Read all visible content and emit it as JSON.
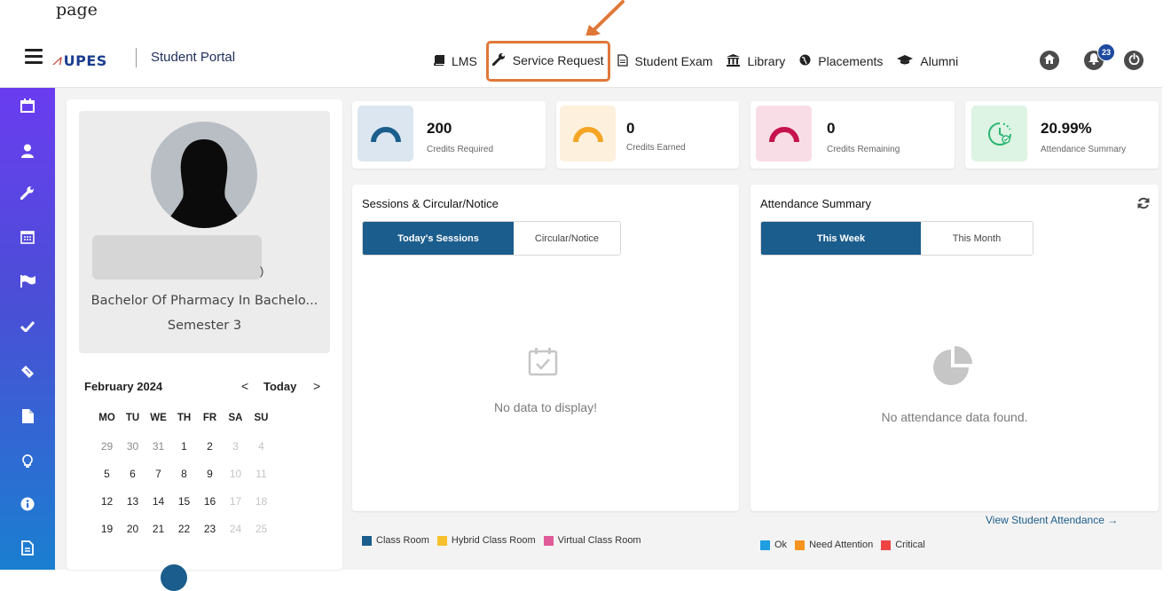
{
  "doc_label": "page",
  "header": {
    "brand": "UPES",
    "portal_title": "Student Portal",
    "nav": [
      {
        "label": "LMS",
        "icon": "book-icon"
      },
      {
        "label": "Service Request",
        "icon": "wrench-icon"
      },
      {
        "label": "Student Exam",
        "icon": "document-icon"
      },
      {
        "label": "Library",
        "icon": "institution-icon"
      },
      {
        "label": "Placements",
        "icon": "globe-icon"
      },
      {
        "label": "Alumni",
        "icon": "graduation-cap-icon"
      }
    ],
    "notification_count": "23",
    "highlight_color": "#e07838"
  },
  "sidebar": {
    "icons": [
      "calendar-icon",
      "user-icon",
      "wrench-icon",
      "calendar-grid-icon",
      "flag-icon",
      "check-icon",
      "ticket-icon",
      "file-icon",
      "lightbulb-icon",
      "info-icon",
      "document-icon"
    ]
  },
  "profile": {
    "program": "Bachelor Of Pharmacy In Bachelo...",
    "semester": "Semester 3",
    "name_tail": ")"
  },
  "calendar": {
    "month": "February 2024",
    "prev": "<",
    "today": "Today",
    "next": ">",
    "weekdays": [
      "MO",
      "TU",
      "WE",
      "TH",
      "FR",
      "SA",
      "SU"
    ],
    "weeks": [
      [
        "29",
        "30",
        "31",
        "1",
        "2",
        "3",
        "4"
      ],
      [
        "5",
        "6",
        "7",
        "8",
        "9",
        "10",
        "11"
      ],
      [
        "12",
        "13",
        "14",
        "15",
        "16",
        "17",
        "18"
      ],
      [
        "19",
        "20",
        "21",
        "22",
        "23",
        "24",
        "25"
      ]
    ]
  },
  "stats": [
    {
      "value": "200",
      "label": "Credits Required",
      "bg": "#dbe6f0",
      "color": "#1b5d8c"
    },
    {
      "value": "0",
      "label": "Credits Earned",
      "bg": "#fdf0dc",
      "color": "#f5a524"
    },
    {
      "value": "0",
      "label": "Credits Remaining",
      "bg": "#f8dde6",
      "color": "#c4134d"
    },
    {
      "value": "20.99%",
      "label": "Attendance Summary",
      "bg": "#ddf3e3",
      "color": "#2bb673"
    }
  ],
  "sessions": {
    "title": "Sessions & Circular/Notice",
    "tabs": [
      "Today's Sessions",
      "Circular/Notice"
    ],
    "empty": "No data to display!",
    "legend": [
      {
        "label": "Class Room",
        "color": "#1b5d8c"
      },
      {
        "label": "Hybrid Class Room",
        "color": "#f5c02c"
      },
      {
        "label": "Virtual Class Room",
        "color": "#e05a9a"
      }
    ]
  },
  "attendance": {
    "title": "Attendance Summary",
    "tabs": [
      "This Week",
      "This Month"
    ],
    "empty": "No attendance data found.",
    "legend": [
      {
        "label": "Ok",
        "color": "#1f9fe0"
      },
      {
        "label": "Need Attention",
        "color": "#f7941d"
      },
      {
        "label": "Critical",
        "color": "#ef4444"
      }
    ],
    "link": "View Student Attendance →"
  }
}
